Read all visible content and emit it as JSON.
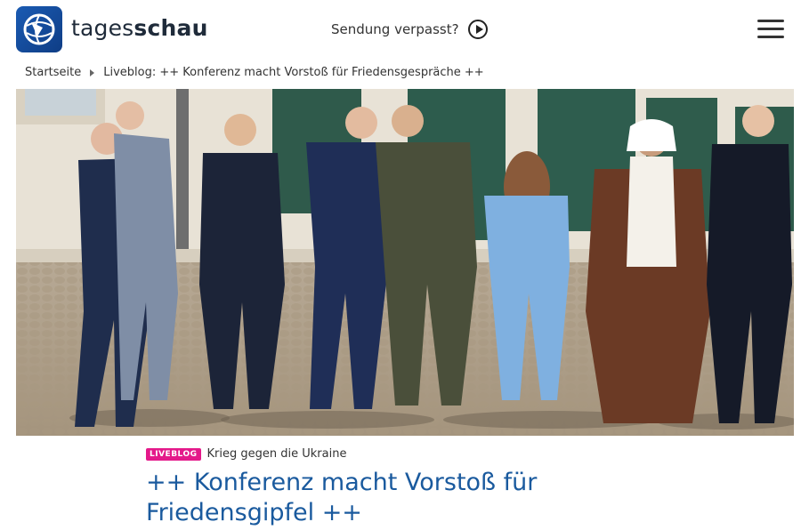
{
  "header": {
    "brand_light": "tages",
    "brand_bold": "schau",
    "sendung_label": "Sendung verpasst?"
  },
  "breadcrumb": {
    "items": [
      "Startseite",
      "Liveblog: ++ Konferenz macht Vorstoß für Friedensgespräche ++"
    ]
  },
  "article": {
    "badge": "LIVEBLOG",
    "topline": "Krieg gegen die Ukraine",
    "headline_lines": [
      "++ Konferenz macht Vorstoß für",
      "Friedensgipfel ++"
    ]
  },
  "colors": {
    "brand_blue": "#1a5bb3",
    "headline_blue": "#1a5a9e",
    "badge_pink": "#e4198a"
  },
  "icons": {
    "logo": "tagesschau-globe-logo",
    "play": "play-circle-icon",
    "menu": "hamburger-menu-icon",
    "separator": "triangle-right-icon"
  }
}
